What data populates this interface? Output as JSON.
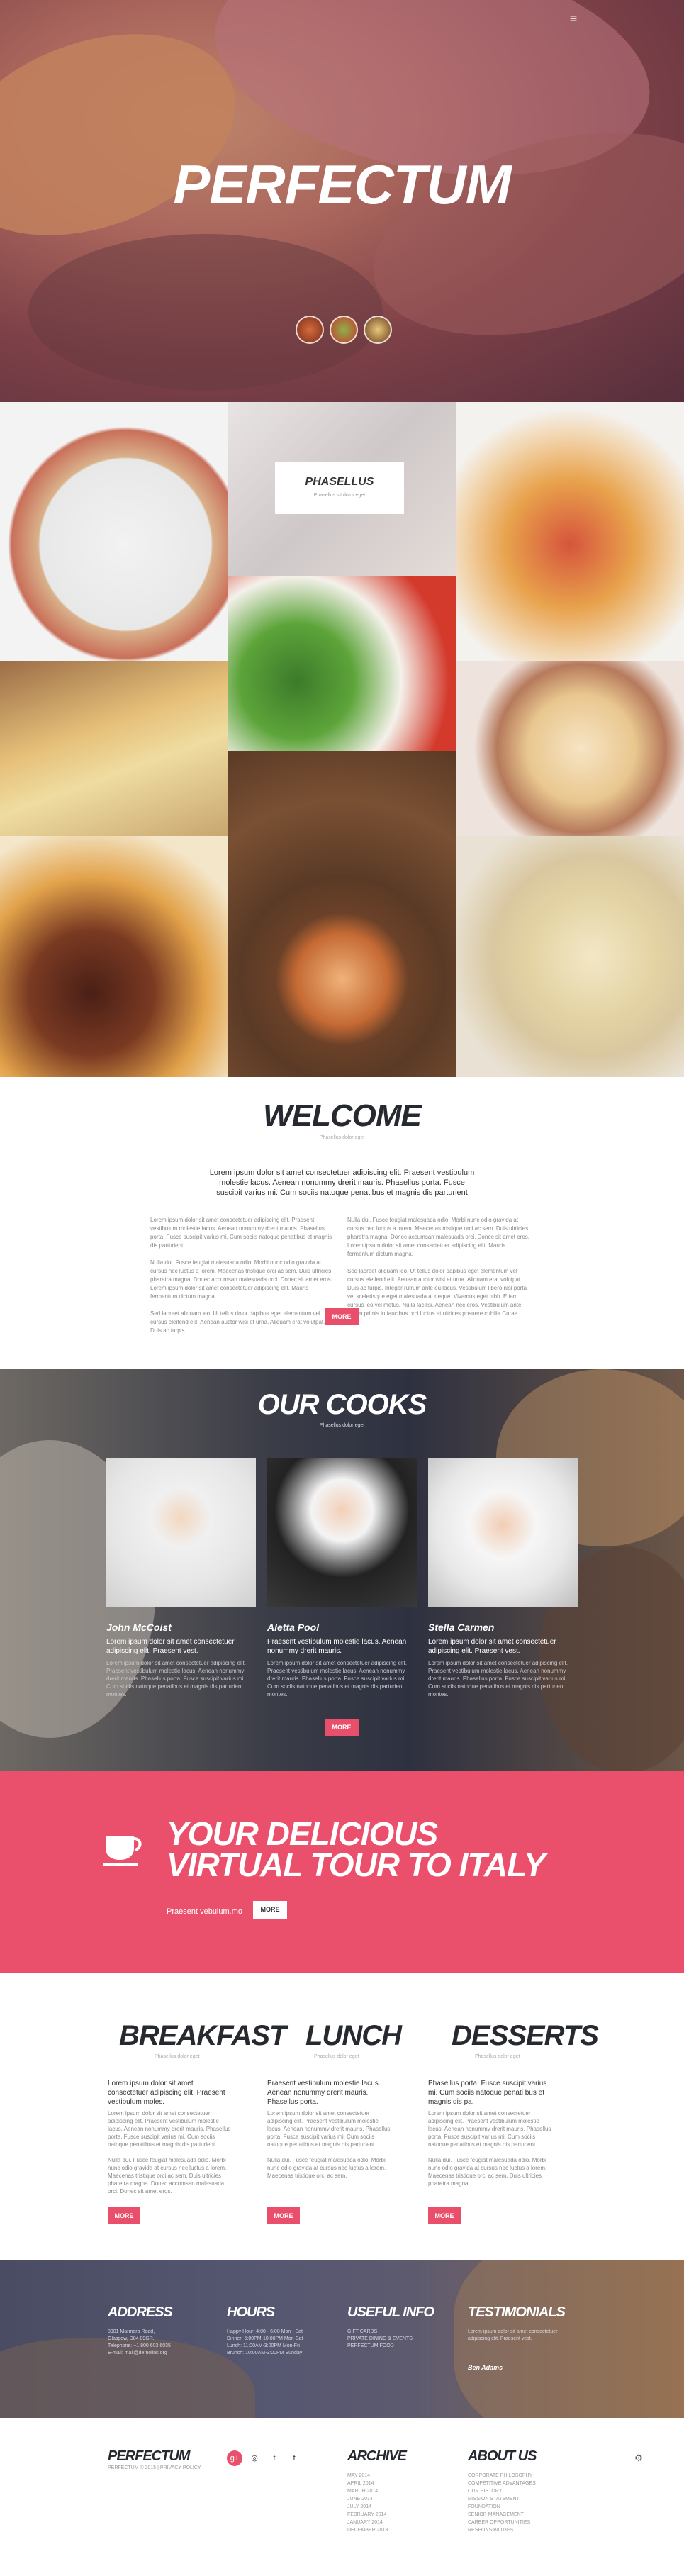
{
  "brand": "PERFECTUM",
  "nav": {
    "menu_icon": "≡"
  },
  "hero": {
    "title": "PERFECTUM"
  },
  "mosaic": {
    "badge_title": "PHASELLUS",
    "badge_sub": "Phasellus sit dolor eget"
  },
  "welcome": {
    "title": "WELCOME",
    "subtitle": "Phasellus dolor eget",
    "lead": "Lorem ipsum dolor sit amet consectetuer adipiscing elit. Praesent vestibulum molestie lacus. Aenean nonummy drerit mauris. Phasellus porta. Fusce suscipit varius mi. Cum sociis natoque penatibus et magnis dis parturient",
    "col1": "Lorem ipsum dolor sit amet consectetuer adipiscing elit. Praesent vestibulum molestie lacus. Aenean nonummy drerit mauris. Phasellus porta. Fusce suscipit varius mi. Cum sociis natoque penatibus et magnis dis parturient.\n\nNulla dui. Fusce feugiat malesuada odio. Morbi nunc odio gravida at cursus nec luctus a lorem. Maecenas tristique orci ac sem. Duis ultricies pharetra magna. Donec accumsan malesuada orci. Donec sit amet eros. Lorem ipsum dolor sit amet consectetuer adipiscing elit. Mauris fermentum dictum magna.\n\nSed laoreet aliquam leo. Ut tellus dolor dapibus eget elementum vel cursus eleifend elit. Aenean auctor wisi et urna. Aliquam erat volutpat. Duis ac turpis.",
    "col2": "Nulla dui. Fusce feugiat malesuada odio. Morbi nunc odio gravida at cursus nec luctus a lorem. Maecenas tristique orci ac sem. Duis ultricies pharetra magna. Donec accumsan malesuada orci. Donec sit amet eros. Lorem ipsum dolor sit amet consectetuer adipiscing elit. Mauris fermentum dictum magna.\n\nSed laoreet aliquam leo. Ut tellus dolor dapibus eget elementum vel cursus eleifend elit. Aenean auctor wisi et urna. Aliquam erat volutpat. Duis ac turpis. Integer rutrum ante eu lacus. Vestibulum libero nisl porta vel scelerisque eget malesuada at neque. Vivamus eget nibh. Etiam cursus leo vel metus. Nulla facilisi. Aenean nec eros. Vestibulum ante ipsum primis in faucibus orci luctus et ultrices posuere cubilia Curae.",
    "more": "MORE"
  },
  "cooks": {
    "title": "OUR COOKS",
    "subtitle": "Phasellus dolor eget",
    "items": [
      {
        "name": "John McCoist",
        "lead": "Lorem ipsum dolor sit amet consectetuer adipiscing elit. Praesent vest.",
        "text": "Lorem ipsum dolor sit amet consectetuer adipiscing elit. Praesent vestibulum molestie lacus. Aenean nonummy drerit mauris. Phasellus porta. Fusce suscipit varius mi. Cum sociis natoque penatibus et magnis dis parturient montes."
      },
      {
        "name": "Aletta Pool",
        "lead": "Praesent vestibulum molestie lacus. Aenean nonummy drerit mauris.",
        "text": "Lorem ipsum dolor sit amet consectetuer adipiscing elit. Praesent vestibulum molestie lacus. Aenean nonummy drerit mauris. Phasellus porta. Fusce suscipit varius mi. Cum sociis natoque penatibus et magnis dis parturient montes."
      },
      {
        "name": "Stella Carmen",
        "lead": "Lorem ipsum dolor sit amet consectetuer adipiscing elit. Praesent vest.",
        "text": "Lorem ipsum dolor sit amet consectetuer adipiscing elit. Praesent vestibulum molestie lacus. Aenean nonummy drerit mauris. Phasellus porta. Fusce suscipit varius mi. Cum sociis natoque penatibus et magnis dis parturient montes."
      }
    ],
    "more": "MORE"
  },
  "tour": {
    "line1": "YOUR DELICIOUS",
    "line2": "VIRTUAL TOUR TO ITALY",
    "text": "Praesent vebulum.mo",
    "more": "MORE"
  },
  "menu": {
    "columns": [
      {
        "title": "BREAKFAST",
        "subtitle": "Phasellus dolor eget",
        "lead": "Lorem ipsum dolor sit amet consectetuer adipiscing elit. Praesent vestibulum moles.",
        "text": "Lorem ipsum dolor sit amet consectetuer adipiscing elit. Praesent vestibulum molestie lacus. Aenean nonummy drerit mauris. Phasellus porta. Fusce suscipit varius mi. Cum sociis natoque penatibus et magnis dis parturient.\n\nNulla dui. Fusce feugiat malesuada odio. Morbi nunc odio gravida at cursus nec luctus a lorem. Maecenas tristique orci ac sem. Duis ultricies pharetra magna. Donec accumsan malesuada orci. Donec sit amet eros.",
        "more": "MORE"
      },
      {
        "title": "LUNCH",
        "subtitle": "Phasellus dolor eget",
        "lead": "Praesent vestibulum molestie lacus. Aenean nonummy drerit mauris. Phasellus porta.",
        "text": "Lorem ipsum dolor sit amet consectetuer adipiscing elit. Praesent vestibulum molestie lacus. Aenean nonummy drerit mauris. Phasellus porta. Fusce suscipit varius mi. Cum sociis natoque penatibus et magnis dis parturient.\n\nNulla dui. Fusce feugiat malesuada odio. Morbi nunc odio gravida at cursus nec luctus a lorem. Maecenas tristique orci ac sem.",
        "more": "MORE"
      },
      {
        "title": "DESSERTS",
        "subtitle": "Phasellus dolor eget",
        "lead": "Phasellus porta. Fusce suscipit varius mi. Cum sociis natoque penati bus et magnis dis pa.",
        "text": "Lorem ipsum dolor sit amet consectetuer adipiscing elit. Praesent vestibulum molestie lacus. Aenean nonummy drerit mauris. Phasellus porta. Fusce suscipit varius mi. Cum sociis natoque penatibus et magnis dis parturient.\n\nNulla dui. Fusce feugiat malesuada odio. Morbi nunc odio gravida at cursus nec luctus a lorem. Maecenas tristique orci ac sem. Duis ultricies pharetra magna.",
        "more": "MORE"
      }
    ]
  },
  "footer_top": {
    "address": {
      "title": "ADDRESS",
      "text": "8901 Marmora Road,\nGlasgow, D04 89GR.\nTelephone: +1 800 603 6035\nE-mail: mail@demolink.org"
    },
    "hours": {
      "title": "HOURS",
      "text": "Happy Hour: 4:00 - 6:00 Mon - Sat\nDinner: 5:00PM-10:00PM Mon-Sat\nLunch: 11:00AM-3:00PM Mon-Fri\nBrunch: 10:00AM-3:00PM Sunday"
    },
    "useful": {
      "title": "USEFUL INFO",
      "text": "GIFT CARDS\nPRIVATE DINING & EVENTS\nPERFECTUM FOOD"
    },
    "testimonials": {
      "title": "TESTIMONIALS",
      "text": "Lorem ipsum dolor sit amet consectetuer adipiscing elit. Praesent vest.",
      "author": "Ben Adams"
    }
  },
  "footer_bottom": {
    "brand": "PERFECTUM",
    "copyright": "PERFECTUM © 2015 | PRIVACY POLICY",
    "social": [
      "g+",
      "◎",
      "t",
      "f"
    ],
    "archive": {
      "title": "ARCHIVE",
      "items": [
        "MAY 2014",
        "APRIL 2014",
        "MARCH 2014",
        "JUNE 2014",
        "JULY 2014",
        "FEBRUARY 2014",
        "JANUARY 2014",
        "DECEMBER 2013"
      ]
    },
    "about": {
      "title": "ABOUT US",
      "items": [
        "CORPORATE PHILOSOPHY",
        "COMPETITIVE ADVANTAGES",
        "OUR HISTORY",
        "MISSION STATEMENT",
        "FOUNDATION",
        "SENIOR MANAGEMENT",
        "CAREER OPPORTUNITIES",
        "RESPONSIBILITIES"
      ]
    },
    "settings_icon": "⚙"
  },
  "colors": {
    "accent": "#ea506c",
    "dark": "#262a30"
  }
}
